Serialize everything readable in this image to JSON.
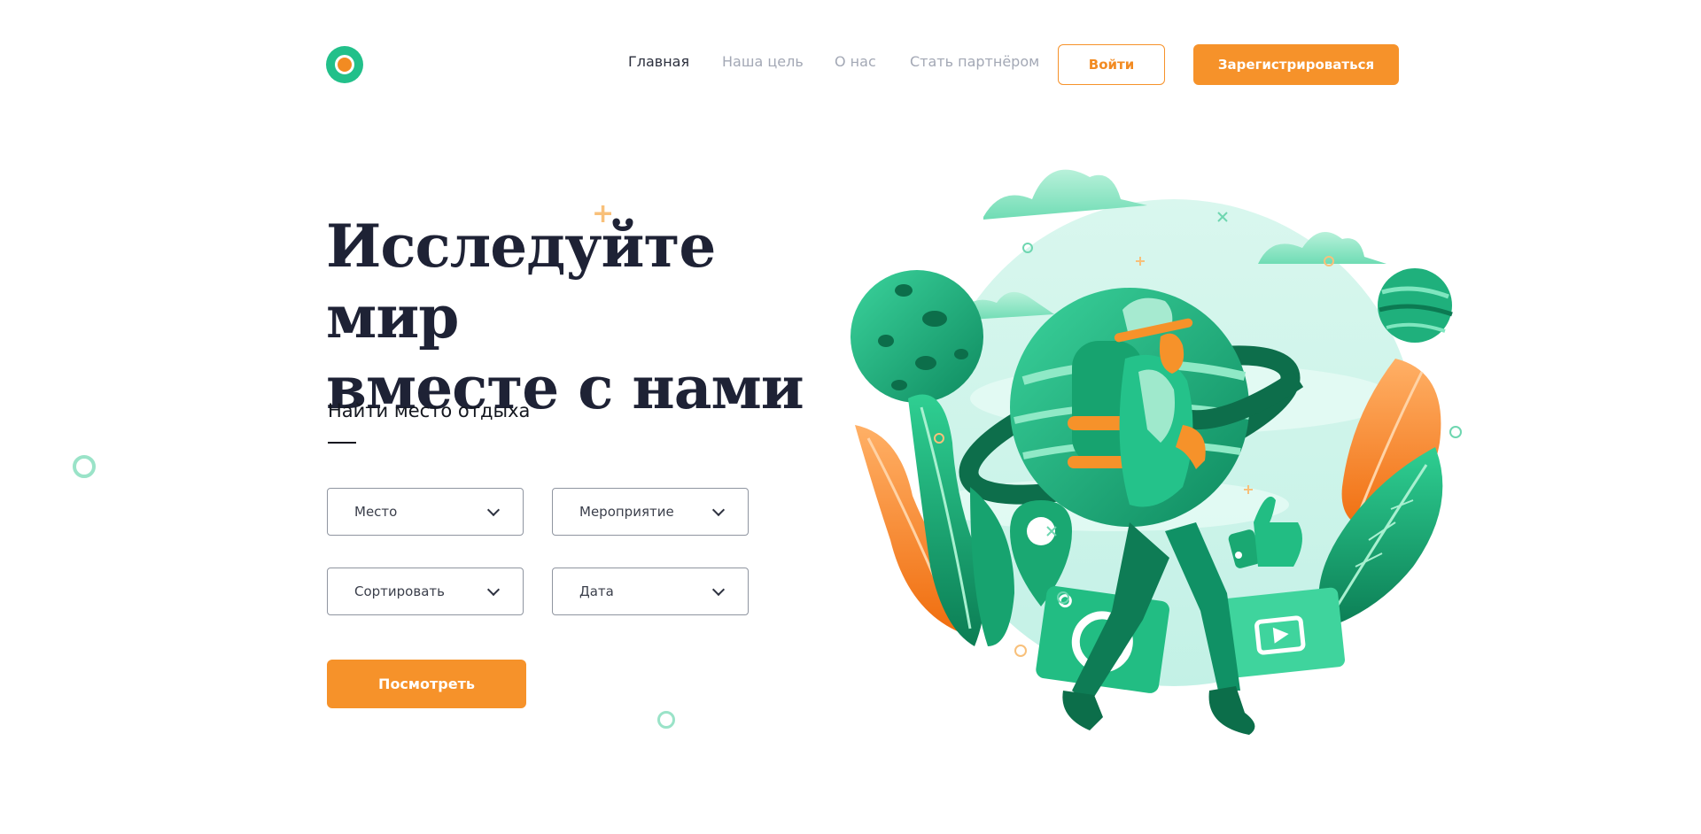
{
  "header": {
    "logo_colors": {
      "outer": "#22c08a",
      "inner": "#f28b22"
    },
    "nav": [
      {
        "label": "Главная",
        "active": true
      },
      {
        "label": "Наша цель",
        "active": false
      },
      {
        "label": "О нас",
        "active": false
      },
      {
        "label": "Стать партнёром",
        "active": false
      }
    ],
    "login_label": "Войти",
    "register_label": "Зарегистрироваться"
  },
  "hero": {
    "title_line1": "Исследуйте мир",
    "title_line2": "вместе с нами",
    "search_heading": "Найти место отдыха",
    "filters": {
      "place": "Место",
      "event": "Мероприятие",
      "sort": "Сортировать",
      "date": "Дата"
    },
    "view_button": "Посмотреть"
  },
  "colors": {
    "accent": "#f6922a",
    "green": "#22c08a",
    "title": "#1e2235",
    "nav_inactive": "#a3a8b5"
  },
  "illustration": {
    "subject": "traveler-with-backpack-planets-illustration",
    "icons": [
      "location-pin-icon",
      "camera-icon",
      "video-play-icon",
      "thumbs-up-icon"
    ]
  }
}
